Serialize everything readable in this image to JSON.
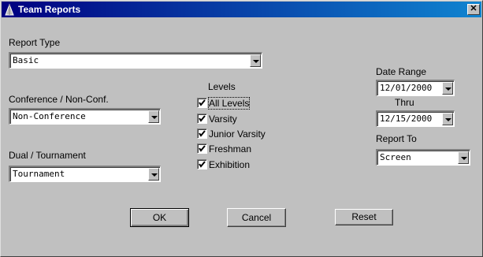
{
  "window": {
    "title": "Team Reports",
    "close_glyph": "✕"
  },
  "report_type": {
    "label": "Report Type",
    "value": "Basic"
  },
  "conference": {
    "label": "Conference / Non-Conf.",
    "value": "Non-Conference"
  },
  "dual": {
    "label": "Dual / Tournament",
    "value": "Tournament"
  },
  "levels": {
    "label": "Levels",
    "items": [
      {
        "label": "All Levels",
        "checked": true
      },
      {
        "label": "Varsity",
        "checked": true
      },
      {
        "label": "Junior Varsity",
        "checked": true
      },
      {
        "label": "Freshman",
        "checked": true
      },
      {
        "label": "Exhibition",
        "checked": true
      }
    ]
  },
  "date_range": {
    "label": "Date Range",
    "from": "12/01/2000",
    "thru_label": "Thru",
    "to": "12/15/2000"
  },
  "report_to": {
    "label": "Report To",
    "value": "Screen"
  },
  "buttons": {
    "ok": "OK",
    "cancel": "Cancel",
    "reset": "Reset"
  },
  "colors": {
    "face": "#c0c0c0",
    "title_start": "#000080",
    "title_end": "#1084d0"
  }
}
